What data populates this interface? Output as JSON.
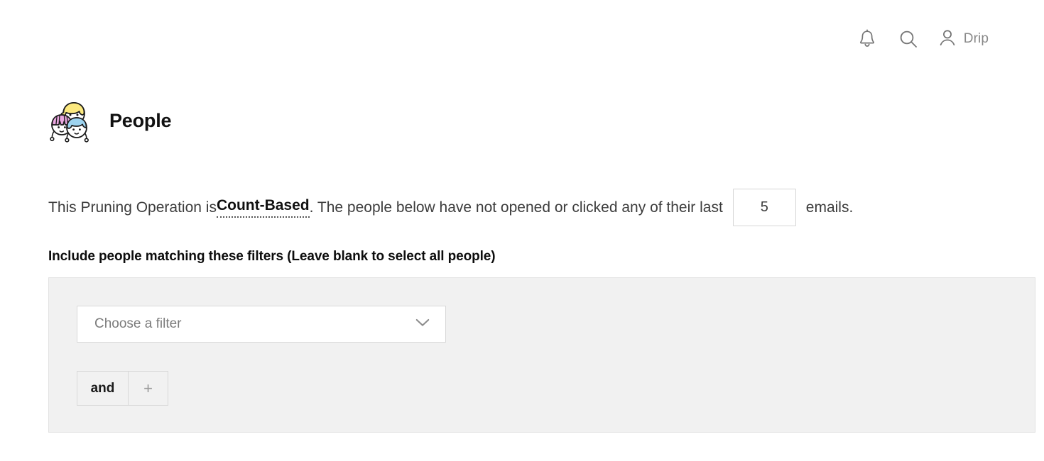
{
  "topbar": {
    "notifications_icon": "bell-icon",
    "search_icon": "search-icon",
    "account_icon": "person-icon",
    "account_name": "Drip"
  },
  "page": {
    "icon": "people-group-emoji",
    "title": "People"
  },
  "description": {
    "prefix": "This Pruning Operation is ",
    "term": "Count-Based",
    "middle": ". The people below have not opened or clicked any of their last",
    "count_value": "5",
    "count_placeholder": "5",
    "suffix": "emails."
  },
  "filters": {
    "label": "Include people matching these filters (Leave blank to select all people)",
    "select_placeholder": "Choose a filter",
    "select_value": "Choose a filter",
    "chevron_icon": "chevron-down-icon",
    "and_label": "and",
    "add_label": "+"
  },
  "colors": {
    "panel_bg": "#f1f1f1",
    "panel_border": "#e2e2e2",
    "text": "#3c3c3c",
    "muted": "#8a8a8a",
    "input_border": "#d6d6d6"
  }
}
